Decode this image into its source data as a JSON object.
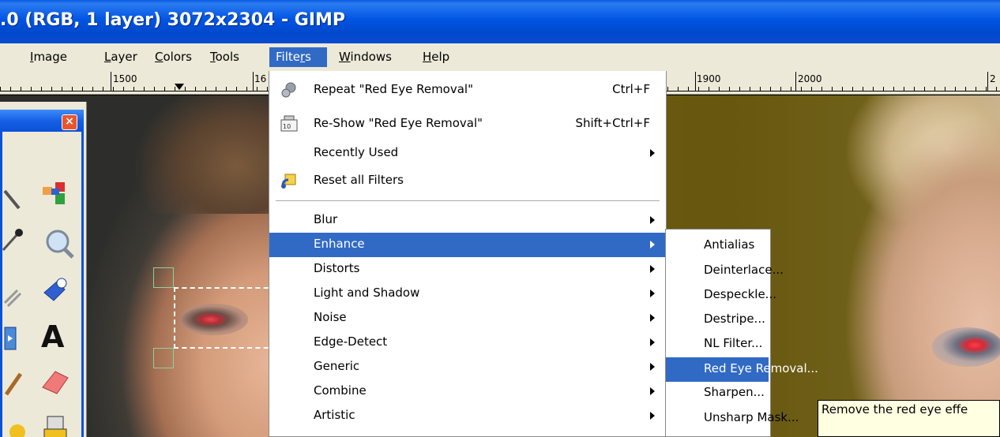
{
  "window": {
    "title": ".0 (RGB, 1 layer) 3072x2304 - GIMP"
  },
  "menubar": {
    "items": [
      {
        "label": "Image",
        "mnemonic_index": 0
      },
      {
        "label": "Layer",
        "mnemonic_index": 0
      },
      {
        "label": "Colors",
        "mnemonic_index": 0
      },
      {
        "label": "Tools",
        "mnemonic_index": 0
      },
      {
        "label": "Filters",
        "mnemonic_index": 5,
        "active": true
      },
      {
        "label": "Windows",
        "mnemonic_index": 0
      },
      {
        "label": "Help",
        "mnemonic_index": 0
      }
    ]
  },
  "ruler": {
    "labels": [
      "1500",
      "16",
      "1900",
      "2000",
      "2"
    ]
  },
  "filters_menu": {
    "repeat": {
      "label": "Repeat \"Red Eye Removal\"",
      "shortcut": "Ctrl+F",
      "icon": "repeat-gears-icon"
    },
    "reshow": {
      "label": "Re-Show \"Red Eye Removal\"",
      "shortcut": "Shift+Ctrl+F",
      "icon": "reshow-dialog-icon"
    },
    "recently_used": {
      "label": "Recently Used"
    },
    "reset_all": {
      "label": "Reset all Filters",
      "icon": "reset-icon"
    },
    "categories": [
      {
        "label": "Blur",
        "key": "B"
      },
      {
        "label": "Enhance",
        "key": "h",
        "highlighted": true
      },
      {
        "label": "Distorts",
        "key": "D"
      },
      {
        "label": "Light and Shadow",
        "key": "L"
      },
      {
        "label": "Noise",
        "key": "N"
      },
      {
        "label": "Edge-Detect",
        "key": "E"
      },
      {
        "label": "Generic",
        "key": "G"
      },
      {
        "label": "Combine",
        "key": "o"
      },
      {
        "label": "Artistic",
        "key": "A"
      }
    ]
  },
  "enhance_submenu": {
    "items": [
      {
        "label": "Antialias"
      },
      {
        "label": "Deinterlace..."
      },
      {
        "label": "Despeckle..."
      },
      {
        "label": "Destripe..."
      },
      {
        "label": "NL Filter..."
      },
      {
        "label": "Red Eye Removal...",
        "highlighted": true
      },
      {
        "label": "Sharpen..."
      },
      {
        "label": "Unsharp Mask..."
      }
    ]
  },
  "tooltip": {
    "text": "Remove the red eye effe"
  },
  "toolbox": {
    "close_label": "×"
  },
  "colors": {
    "selection_blue": "#316ac5",
    "menu_background": "#ece9d8",
    "tooltip_background": "#ffffe1",
    "titlebar_blue": "#0055e3"
  }
}
